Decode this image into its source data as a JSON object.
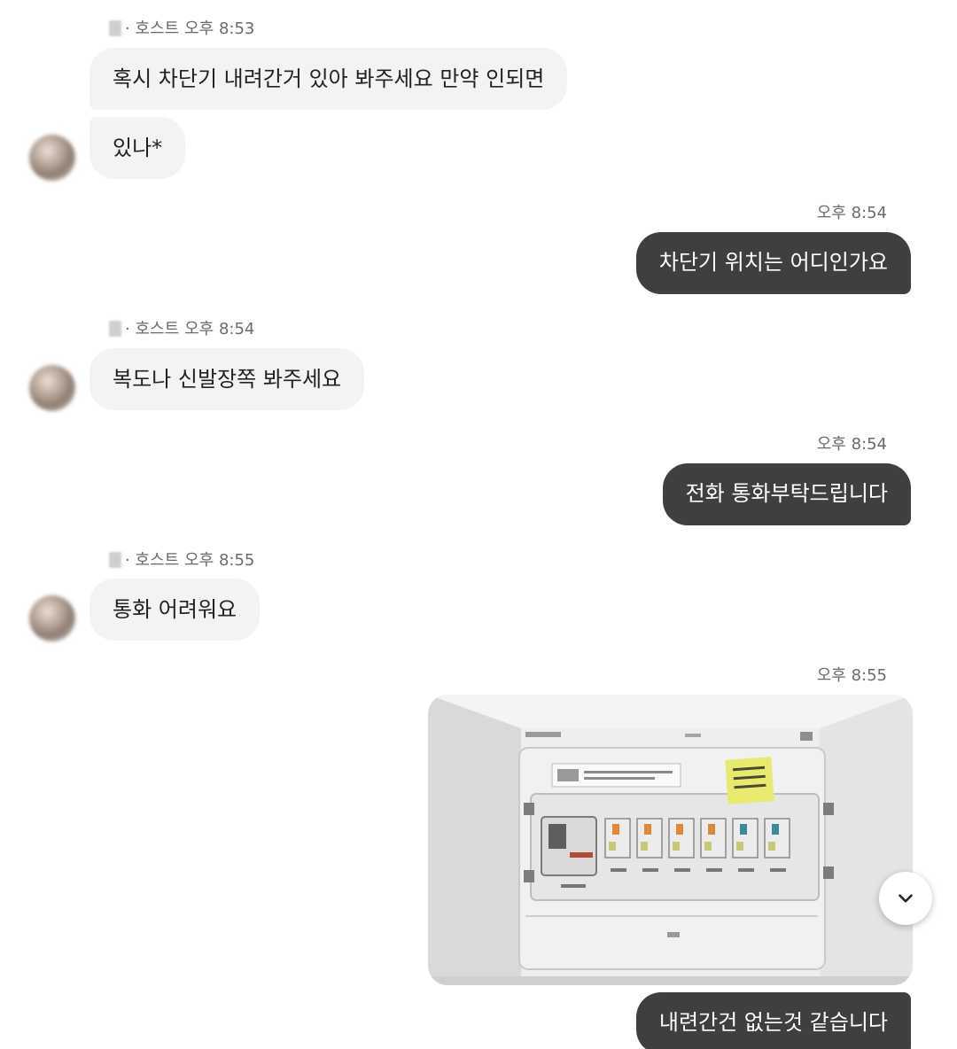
{
  "messages": [
    {
      "sender_role": "· 호스트",
      "time": "오후 8:53",
      "bubbles": [
        "혹시 차단기 내려간거 있아 봐주세요 만약 인되면",
        "있나*"
      ]
    },
    {
      "time": "오후 8:54",
      "text": "차단기 위치는 어디인가요"
    },
    {
      "sender_role": "· 호스트",
      "time": "오후 8:54",
      "bubbles": [
        "복도나 신발장쪽 봐주세요"
      ]
    },
    {
      "time": "오후 8:54",
      "text": "전화 통화부탁드립니다"
    },
    {
      "sender_role": "· 호스트",
      "time": "오후 8:55",
      "bubbles": [
        "통화 어려워요"
      ]
    },
    {
      "time": "오후 8:55",
      "image": "breaker-panel-photo",
      "text": "내련간건 없는것 같습니다"
    }
  ],
  "colors": {
    "incoming_bubble": "#f3f3f3",
    "outgoing_bubble": "#3f3f3f",
    "meta_text": "#6b6b6b"
  },
  "icons": {
    "scroll_down": "chevron-down-icon"
  }
}
